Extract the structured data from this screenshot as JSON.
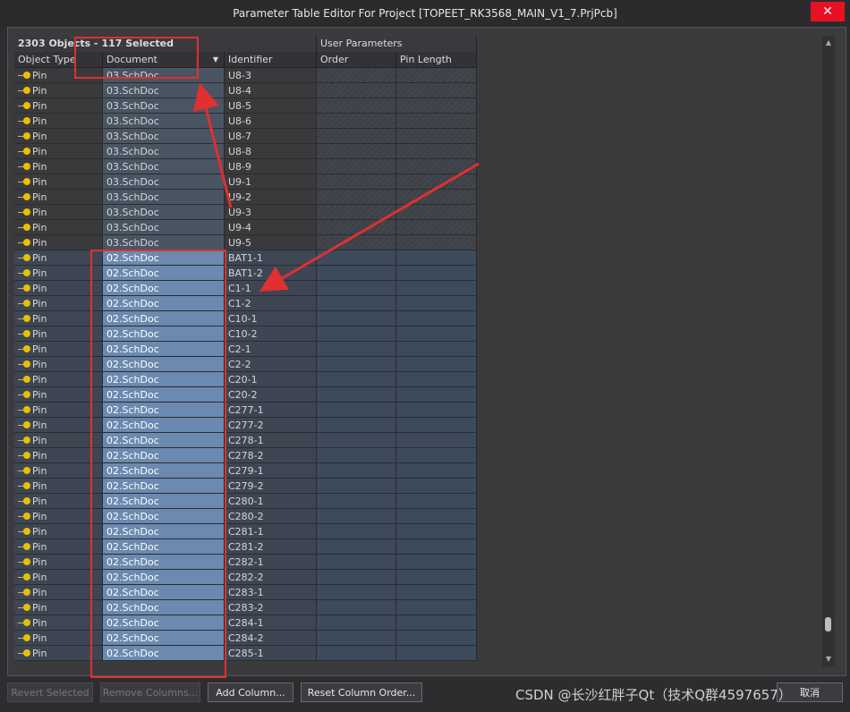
{
  "window": {
    "title": "Parameter Table Editor For Project [TOPEET_RK3568_MAIN_V1_7.PrjPcb]",
    "close_label": "✕"
  },
  "header": {
    "objects_count": "2303 Objects - 117 Selected",
    "user_params": "User Parameters",
    "columns": [
      "Object Type",
      "Document",
      "Identifier",
      "Order",
      "Pin Length"
    ],
    "sort_arrow": "▼"
  },
  "rows": [
    {
      "type": "Pin",
      "doc": "03.SchDoc",
      "id": "U8-3",
      "sel": false
    },
    {
      "type": "Pin",
      "doc": "03.SchDoc",
      "id": "U8-4",
      "sel": false
    },
    {
      "type": "Pin",
      "doc": "03.SchDoc",
      "id": "U8-5",
      "sel": false
    },
    {
      "type": "Pin",
      "doc": "03.SchDoc",
      "id": "U8-6",
      "sel": false
    },
    {
      "type": "Pin",
      "doc": "03.SchDoc",
      "id": "U8-7",
      "sel": false
    },
    {
      "type": "Pin",
      "doc": "03.SchDoc",
      "id": "U8-8",
      "sel": false
    },
    {
      "type": "Pin",
      "doc": "03.SchDoc",
      "id": "U8-9",
      "sel": false
    },
    {
      "type": "Pin",
      "doc": "03.SchDoc",
      "id": "U9-1",
      "sel": false
    },
    {
      "type": "Pin",
      "doc": "03.SchDoc",
      "id": "U9-2",
      "sel": false
    },
    {
      "type": "Pin",
      "doc": "03.SchDoc",
      "id": "U9-3",
      "sel": false
    },
    {
      "type": "Pin",
      "doc": "03.SchDoc",
      "id": "U9-4",
      "sel": false
    },
    {
      "type": "Pin",
      "doc": "03.SchDoc",
      "id": "U9-5",
      "sel": false
    },
    {
      "type": "Pin",
      "doc": "02.SchDoc",
      "id": "BAT1-1",
      "sel": true
    },
    {
      "type": "Pin",
      "doc": "02.SchDoc",
      "id": "BAT1-2",
      "sel": true
    },
    {
      "type": "Pin",
      "doc": "02.SchDoc",
      "id": "C1-1",
      "sel": true
    },
    {
      "type": "Pin",
      "doc": "02.SchDoc",
      "id": "C1-2",
      "sel": true
    },
    {
      "type": "Pin",
      "doc": "02.SchDoc",
      "id": "C10-1",
      "sel": true
    },
    {
      "type": "Pin",
      "doc": "02.SchDoc",
      "id": "C10-2",
      "sel": true
    },
    {
      "type": "Pin",
      "doc": "02.SchDoc",
      "id": "C2-1",
      "sel": true
    },
    {
      "type": "Pin",
      "doc": "02.SchDoc",
      "id": "C2-2",
      "sel": true
    },
    {
      "type": "Pin",
      "doc": "02.SchDoc",
      "id": "C20-1",
      "sel": true
    },
    {
      "type": "Pin",
      "doc": "02.SchDoc",
      "id": "C20-2",
      "sel": true
    },
    {
      "type": "Pin",
      "doc": "02.SchDoc",
      "id": "C277-1",
      "sel": true
    },
    {
      "type": "Pin",
      "doc": "02.SchDoc",
      "id": "C277-2",
      "sel": true
    },
    {
      "type": "Pin",
      "doc": "02.SchDoc",
      "id": "C278-1",
      "sel": true
    },
    {
      "type": "Pin",
      "doc": "02.SchDoc",
      "id": "C278-2",
      "sel": true
    },
    {
      "type": "Pin",
      "doc": "02.SchDoc",
      "id": "C279-1",
      "sel": true
    },
    {
      "type": "Pin",
      "doc": "02.SchDoc",
      "id": "C279-2",
      "sel": true
    },
    {
      "type": "Pin",
      "doc": "02.SchDoc",
      "id": "C280-1",
      "sel": true
    },
    {
      "type": "Pin",
      "doc": "02.SchDoc",
      "id": "C280-2",
      "sel": true
    },
    {
      "type": "Pin",
      "doc": "02.SchDoc",
      "id": "C281-1",
      "sel": true
    },
    {
      "type": "Pin",
      "doc": "02.SchDoc",
      "id": "C281-2",
      "sel": true
    },
    {
      "type": "Pin",
      "doc": "02.SchDoc",
      "id": "C282-1",
      "sel": true
    },
    {
      "type": "Pin",
      "doc": "02.SchDoc",
      "id": "C282-2",
      "sel": true
    },
    {
      "type": "Pin",
      "doc": "02.SchDoc",
      "id": "C283-1",
      "sel": true
    },
    {
      "type": "Pin",
      "doc": "02.SchDoc",
      "id": "C283-2",
      "sel": true
    },
    {
      "type": "Pin",
      "doc": "02.SchDoc",
      "id": "C284-1",
      "sel": true
    },
    {
      "type": "Pin",
      "doc": "02.SchDoc",
      "id": "C284-2",
      "sel": true
    },
    {
      "type": "Pin",
      "doc": "02.SchDoc",
      "id": "C285-1",
      "sel": true
    }
  ],
  "buttons": {
    "revert_selected": "Revert Selected",
    "remove_columns": "Remove Columns...",
    "add_column": "Add Column...",
    "reset_column_order": "Reset Column Order...",
    "cancel": "取消"
  },
  "watermark": "CSDN @长沙红胖子Qt（技术Q群4597657）",
  "colors": {
    "accent_red": "#e03030",
    "selection": "#6a8ab0",
    "close_red": "#e81123"
  }
}
